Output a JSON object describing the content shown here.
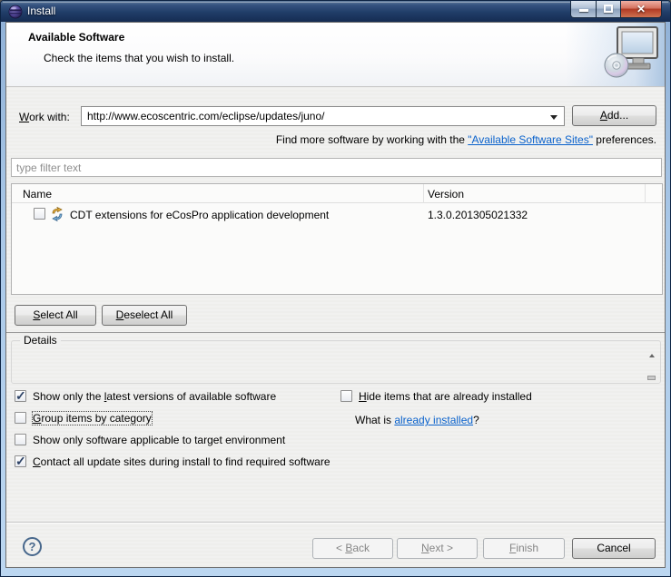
{
  "window": {
    "title": "Install"
  },
  "header": {
    "title": "Available Software",
    "subtitle": "Check the items that you wish to install."
  },
  "work_with": {
    "label_key": "W",
    "label_post": "ork with:",
    "url": "http://www.ecoscentric.com/eclipse/updates/juno/"
  },
  "find_more": {
    "pre": "Find more software by working with the ",
    "link": "\"Available Software Sites\"",
    "post": " preferences."
  },
  "filter": {
    "placeholder": "type filter text"
  },
  "table": {
    "columns": [
      "Name",
      "Version"
    ],
    "rows": [
      {
        "name": "CDT extensions for eCosPro application development",
        "version": "1.3.0.201305021332",
        "checked": false
      }
    ]
  },
  "buttons": {
    "add": {
      "key": "A",
      "post": "dd..."
    },
    "select_all": {
      "key": "S",
      "post": "elect All"
    },
    "deselect_all": {
      "key": "D",
      "post": "eselect All"
    }
  },
  "details": {
    "legend": "Details"
  },
  "options": {
    "left": [
      {
        "pre": "Show only the ",
        "key": "l",
        "post": "atest versions of available software",
        "checked": true
      },
      {
        "pre": "",
        "key": "G",
        "post": "roup items by category",
        "checked": false
      },
      {
        "pre": "Show only software applicable to target environment",
        "key": "",
        "post": "",
        "checked": false
      },
      {
        "pre": "",
        "key": "C",
        "post": "ontact all update sites during install to find required software",
        "checked": true
      }
    ],
    "hide": {
      "pre": "",
      "key": "H",
      "post": "ide items that are already installed",
      "checked": false
    },
    "what_is": {
      "pre": "What is ",
      "link": "already installed",
      "post": "?"
    }
  },
  "footer": {
    "back": {
      "pre": "< ",
      "key": "B",
      "post": "ack",
      "enabled": false
    },
    "next": {
      "pre": "",
      "key": "N",
      "post": "ext >",
      "enabled": false
    },
    "finish": {
      "pre": "",
      "key": "F",
      "post": "inish",
      "enabled": false
    },
    "cancel": {
      "label": "Cancel",
      "enabled": true
    },
    "help_symbol": "?"
  },
  "colors": {
    "titlebar": "#203d68",
    "close_button": "#b03a24",
    "link": "#0a62cc",
    "dialog_background": "#f0f0ef"
  }
}
